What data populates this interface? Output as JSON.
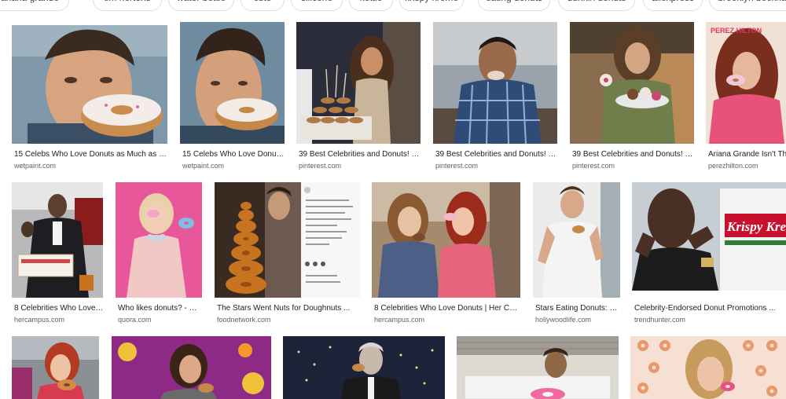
{
  "chips": [
    "ariana grande",
    "tim hortons",
    "water bottle",
    "cute",
    "silicone",
    "kettle",
    "krispy kreme",
    "eating donuts",
    "dunkin donuts",
    "aliexpress",
    "brooklyn beckham"
  ],
  "results": [
    {
      "title": "15 Celebs Who Love Donuts as Much as Us ...",
      "source": "wetpaint.com"
    },
    {
      "title": "15 Celebs Who Love Donuts ...",
      "source": "wetpaint.com"
    },
    {
      "title": "39 Best Celebrities and Donuts! im...",
      "source": "pinterest.com"
    },
    {
      "title": "39 Best Celebrities and Donuts! im...",
      "source": "pinterest.com"
    },
    {
      "title": "39 Best Celebrities and Donuts! im...",
      "source": "pinterest.com"
    },
    {
      "title": "Ariana Grande Isn't The",
      "source": "perezhilton.com"
    },
    {
      "title": "8 Celebrities Who Love ...",
      "source": "hercampus.com"
    },
    {
      "title": "Who likes donuts? - Qu...",
      "source": "quora.com"
    },
    {
      "title": "The Stars Went Nuts for Doughnuts ...",
      "source": "foodnetwork.com"
    },
    {
      "title": "8 Celebrities Who Love Donuts | Her Cam...",
      "source": "hercampus.com"
    },
    {
      "title": "Stars Eating Donuts: Pi...",
      "source": "hollywoodlife.com"
    },
    {
      "title": "Celebrity-Endorsed Donut Promotions ...",
      "source": "trendhunter.com"
    }
  ],
  "image_text": {
    "perez_logo": "PEREZ HILTON",
    "krispy_sign": "Krispy Kreme"
  },
  "colors": {
    "chip_border": "#dadce0",
    "caption": "#222222",
    "source": "#5f6368"
  }
}
